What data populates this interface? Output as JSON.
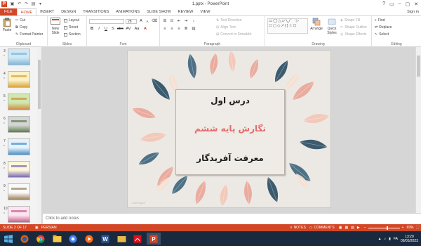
{
  "window": {
    "title": "1.pptx - PowerPoint",
    "signin": "Sign in",
    "app_icon": "P",
    "qat": [
      "save-icon",
      "undo-icon",
      "redo-icon",
      "slideshow-icon",
      "customize-qat-icon"
    ],
    "controls": [
      "?",
      "▭",
      "–",
      "▢",
      "✕"
    ]
  },
  "tabs": [
    "FILE",
    "HOME",
    "INSERT",
    "DESIGN",
    "TRANSITIONS",
    "ANIMATIONS",
    "SLIDE SHOW",
    "REVIEW",
    "VIEW"
  ],
  "active_tab": "HOME",
  "ribbon": {
    "clipboard": {
      "label": "Clipboard",
      "paste": "Paste",
      "cut": "Cut",
      "copy": "Copy",
      "format_painter": "Format Painter"
    },
    "slides": {
      "label": "Slides",
      "new_slide": "New Slide",
      "layout": "Layout",
      "reset": "Reset",
      "section": "Section"
    },
    "font": {
      "label": "Font",
      "font_size": "28",
      "buttons": [
        "B",
        "I",
        "U",
        "S",
        "abc",
        "AV",
        "Aa",
        "A"
      ]
    },
    "paragraph": {
      "label": "Paragraph",
      "text_direction": "Text Direction",
      "align_text": "Align Text",
      "convert_smartart": "Convert to SmartArt"
    },
    "drawing": {
      "label": "Drawing",
      "arrange": "Arrange",
      "quick_styles": "Quick Styles",
      "shape_fill": "Shape Fill",
      "shape_outline": "Shape Outline",
      "shape_effects": "Shape Effects"
    },
    "editing": {
      "label": "Editing",
      "find": "Find",
      "replace": "Replace",
      "select": "Select"
    }
  },
  "thumbnails": [
    {
      "num": "3",
      "star": "*",
      "colors": [
        "#cfe8f5",
        "#7fb7d8"
      ]
    },
    {
      "num": "4",
      "star": "*",
      "colors": [
        "#fbf2c5",
        "#d9a441"
      ]
    },
    {
      "num": "5",
      "star": "*",
      "colors": [
        "#cfe8b0",
        "#d58a3c"
      ]
    },
    {
      "num": "6",
      "star": "*",
      "colors": [
        "#d5d5d5",
        "#5d7e4a"
      ]
    },
    {
      "num": "7",
      "star": "*",
      "colors": [
        "#e6f2fb",
        "#4a8fc9"
      ]
    },
    {
      "num": "8",
      "star": "*",
      "colors": [
        "#fff7da",
        "#7b6bb0"
      ]
    },
    {
      "num": "9",
      "star": "*",
      "colors": [
        "#fafafa",
        "#9f7f5a"
      ]
    },
    {
      "num": "10",
      "star": "*",
      "colors": [
        "#fde5f0",
        "#c75f8f"
      ]
    }
  ],
  "slide": {
    "line1": "درس اول",
    "line2": "نگارش پایه ششم",
    "line3": "معرفت آفریدگار",
    "footer": "ZiziPicture",
    "leaf_colors": [
      "#2c4e64",
      "#e9a699",
      "#f2c6b6",
      "#40667e",
      "#f5e0d2"
    ]
  },
  "notes_placeholder": "Click to add notes",
  "status": {
    "slide_info": "SLIDE 2 OF 17",
    "language": "PERSIAN",
    "notes": "NOTES",
    "comments": "COMMENTS",
    "zoom": "69%",
    "zoom_fraction": 0.69
  },
  "taskbar": {
    "apps": [
      "windows-start-icon",
      "firefox-icon",
      "chrome-icon",
      "file-explorer-icon",
      "chrome-icon",
      "media-icon",
      "word-icon",
      "folder-icon",
      "acrobat-icon",
      "powerpoint-icon"
    ],
    "language": "FA",
    "time": "13:20",
    "date": "09/05/2023"
  },
  "colors": {
    "accent": "#d24726",
    "taskbar": "#1a2a3e"
  }
}
